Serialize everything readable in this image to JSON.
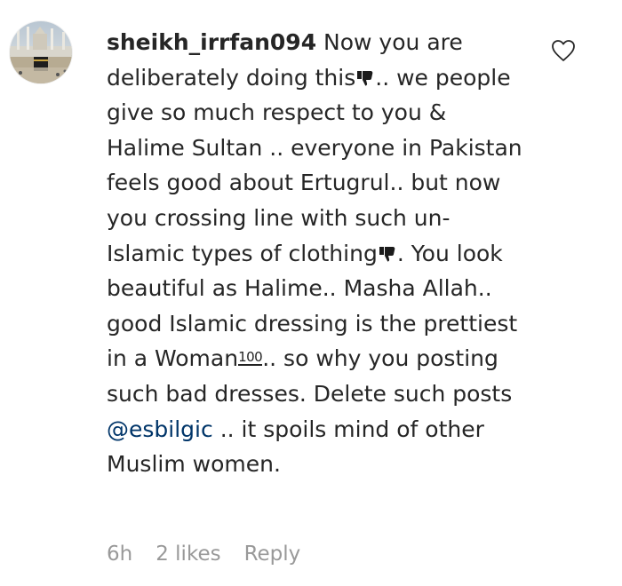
{
  "comment": {
    "username": "sheikh_irrfan094",
    "text_1": "Now you are deliberately doing this",
    "text_2": ".. we people give so much respect to you & Halime Sultan .. everyone in Pakistan feels good about Ertugrul.. but now you crossing line with such un-Islamic types of clothing",
    "text_3": ". You look beautiful as Halime.. Masha Allah.. good Islamic dressing is the prettiest in a Woman",
    "hundred_emoji": "100",
    "text_4": ".. so why you posting such bad dresses. Delete such posts",
    "mention": "@esbilgic",
    "text_5": ".. it spoils mind of other Muslim women.",
    "emojis": [
      "thumbs-down-emoji",
      "thumbs-down-emoji",
      "hundred-points-emoji"
    ]
  },
  "meta": {
    "time": "6h",
    "likes": "2 likes",
    "reply": "Reply"
  },
  "icons": {
    "like": "heart-outline-icon",
    "avatar": "mosque-photo"
  },
  "colors": {
    "text": "#262626",
    "meta": "#999999",
    "mention": "#003569"
  }
}
